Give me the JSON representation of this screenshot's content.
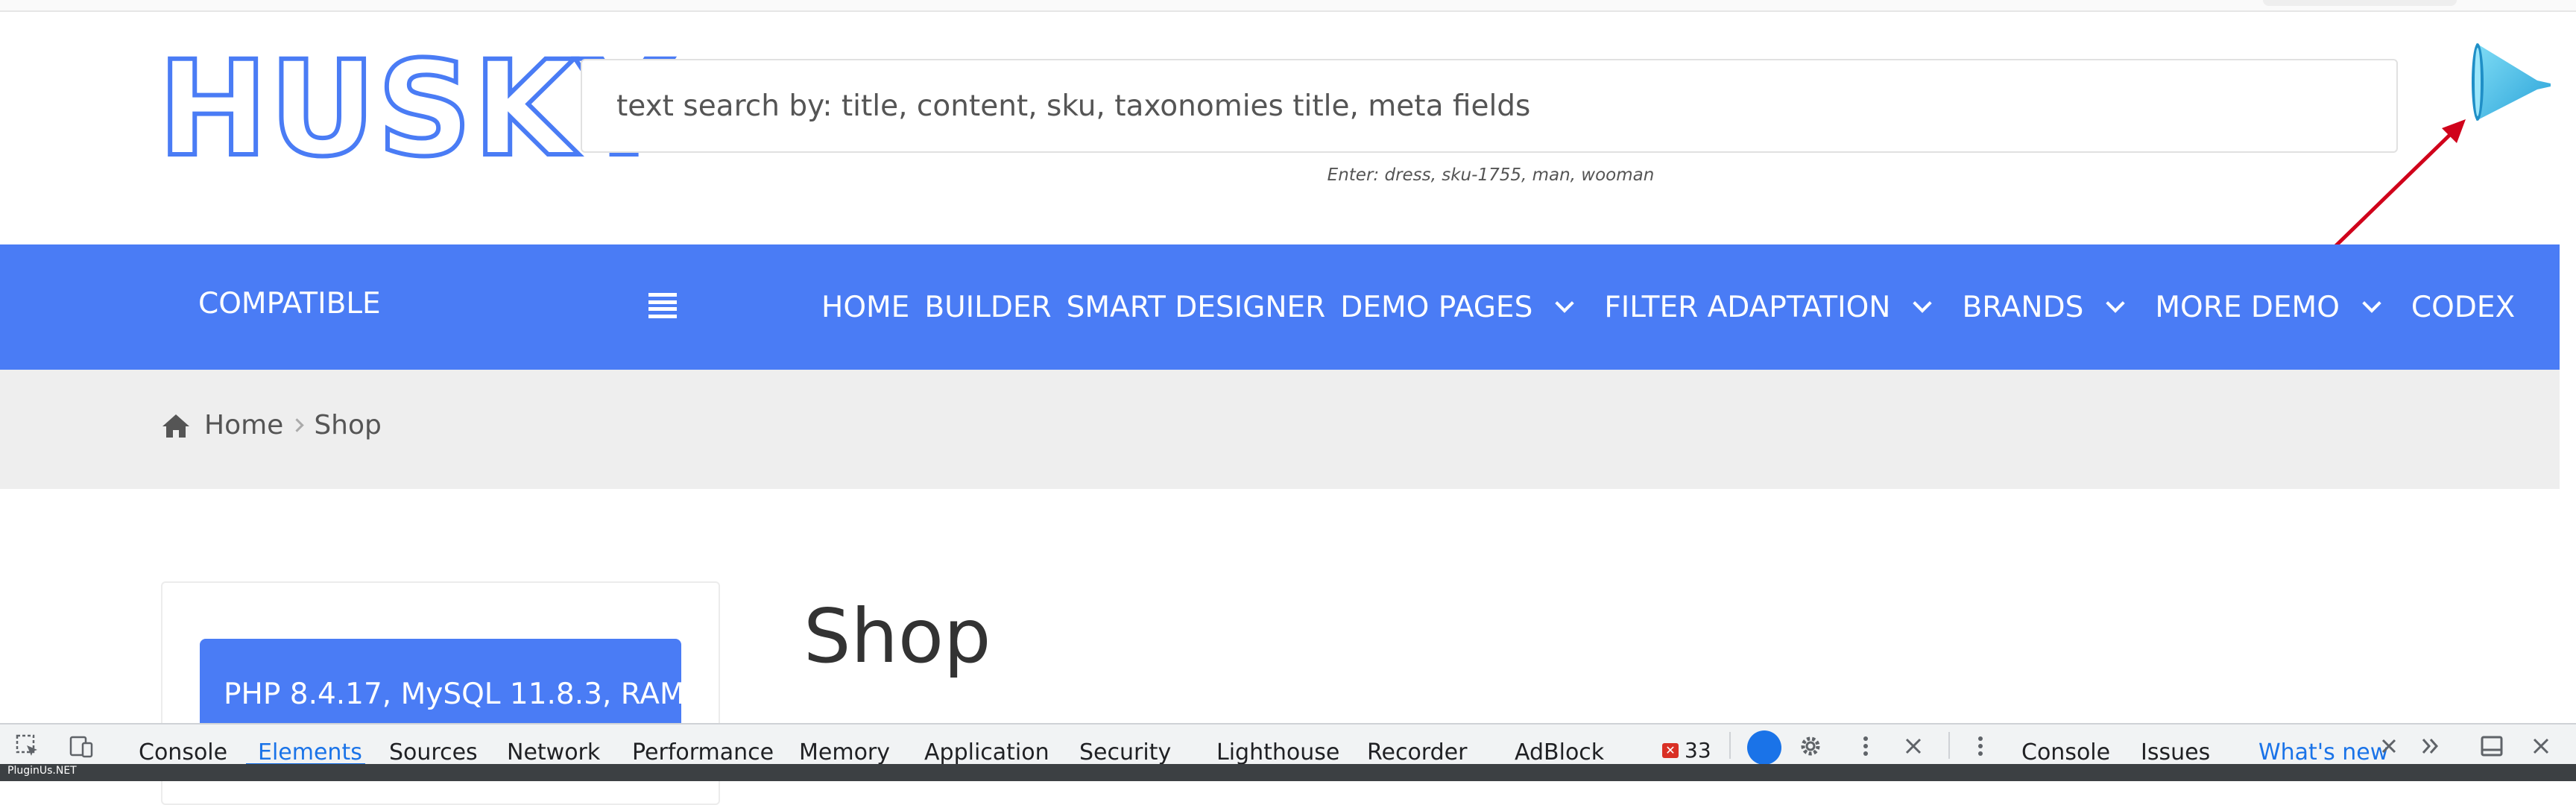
{
  "header": {
    "logo": "HUSKY",
    "search_placeholder": "text search by: title, content, sku, taxonomies title, meta fields",
    "search_hint": "Enter: dress, sku-1755, man, wooman"
  },
  "navbar": {
    "compatible_label": "COMPATIBLE",
    "items": [
      {
        "label": "HOME"
      },
      {
        "label": "BUILDER"
      },
      {
        "label": "SMART DESIGNER"
      },
      {
        "label": "DEMO PAGES"
      },
      {
        "label": "FILTER ADAPTATION"
      },
      {
        "label": "BRANDS"
      },
      {
        "label": "MORE DEMO"
      },
      {
        "label": "CODEX"
      }
    ]
  },
  "breadcrumb": {
    "home": "Home",
    "current": "Shop"
  },
  "main": {
    "title": "Shop",
    "info_button": "PHP 8.4.17, MySQL 11.8.3, RAM"
  },
  "devtools": {
    "tabs": [
      "Console",
      "Elements",
      "Sources",
      "Network",
      "Performance",
      "Memory",
      "Application",
      "Security",
      "Lighthouse",
      "Recorder",
      "AdBlock"
    ],
    "active_tab": "Elements",
    "error_count": "33",
    "drawer_tabs": [
      "Console",
      "Issues"
    ],
    "whats_new": "What's new"
  },
  "watermark": "PluginUs.NET",
  "colors": {
    "accent": "#4a7cf5",
    "nav_text": "#ffffff",
    "breadcrumb_bg": "#eeeeee",
    "devtools_active": "#1a73e8",
    "arrow": "#d0021b"
  }
}
